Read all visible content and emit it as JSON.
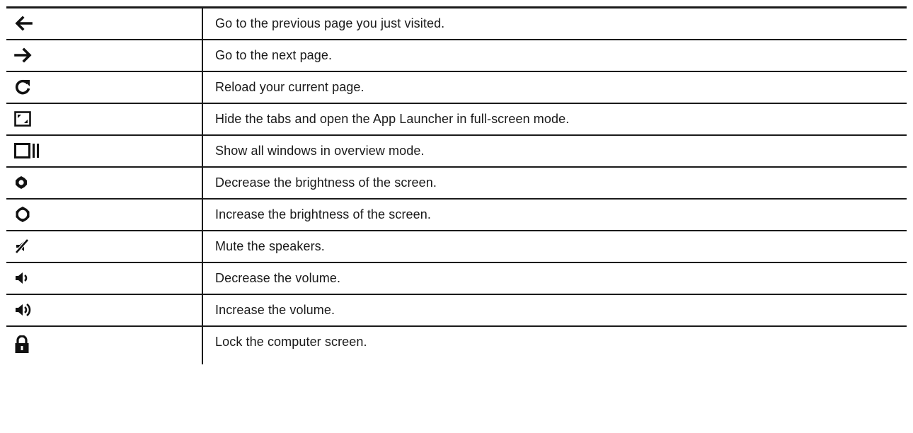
{
  "rows": [
    {
      "icon": "back-arrow-icon",
      "description": "Go to the previous page you just visited."
    },
    {
      "icon": "forward-arrow-icon",
      "description": "Go to the next page."
    },
    {
      "icon": "reload-icon",
      "description": "Reload your current page."
    },
    {
      "icon": "full-screen-icon",
      "description": "Hide the tabs and open the App Launcher in full-screen mode."
    },
    {
      "icon": "overview-mode-icon",
      "description": "Show all windows in overview mode."
    },
    {
      "icon": "brightness-down-icon",
      "description": "Decrease the brightness of the screen."
    },
    {
      "icon": "brightness-up-icon",
      "description": "Increase the brightness of the screen."
    },
    {
      "icon": "mute-icon",
      "description": "Mute the speakers."
    },
    {
      "icon": "volume-down-icon",
      "description": "Decrease the volume."
    },
    {
      "icon": "volume-up-icon",
      "description": "Increase the volume."
    },
    {
      "icon": "lock-icon",
      "description": "Lock the computer screen."
    }
  ]
}
